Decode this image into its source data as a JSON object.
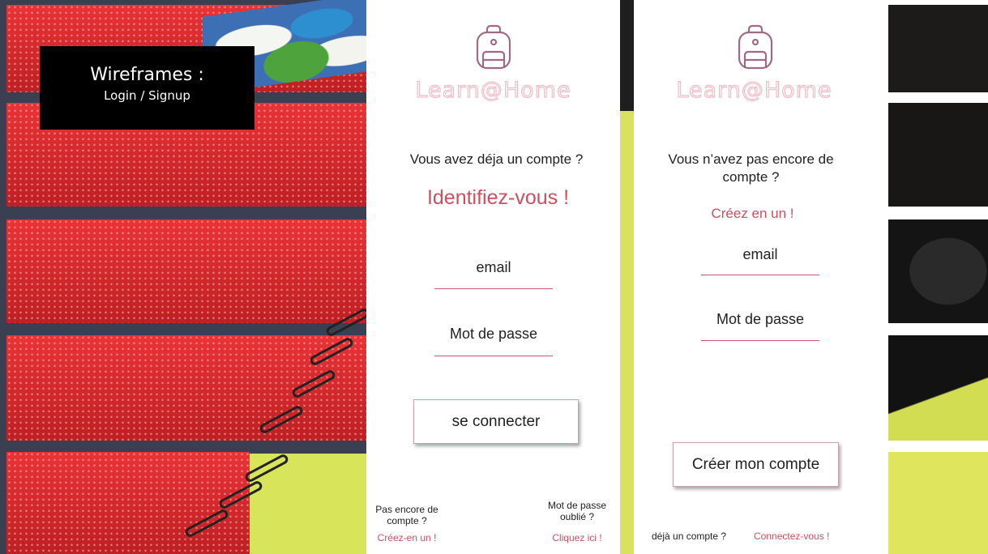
{
  "title_box": {
    "title": "Wireframes :",
    "subtitle": "Login / Signup"
  },
  "login": {
    "brand": "Learn@Home",
    "icon": "backpack-icon",
    "prompt": "Vous avez déja un compte ?",
    "cta": "Identifiez-vous !",
    "email_label": "email",
    "password_label": "Mot de passe",
    "submit_label": "se connecter",
    "footer_left_text": "Pas encore de compte ?",
    "footer_left_link": "Créez-en un !",
    "footer_right_text": "Mot de passe oublié ?",
    "footer_right_link": "Cliquez ici !"
  },
  "signup": {
    "brand": "Learn@Home",
    "icon": "backpack-icon",
    "prompt": "Vous n’avez pas encore de compte ?",
    "cta": "Créez en un !",
    "email_label": "email",
    "password_label": "Mot de passe",
    "submit_label": "Créer mon compte",
    "footer_text": "déjà un compte ?",
    "footer_link": "Connectez-vous !"
  },
  "colors": {
    "accent": "#d24d5f",
    "brand_outline": "#f1b7c2",
    "icon": "#a06a86",
    "notebook_red": "#e8262a",
    "lime": "#d8e45a"
  }
}
